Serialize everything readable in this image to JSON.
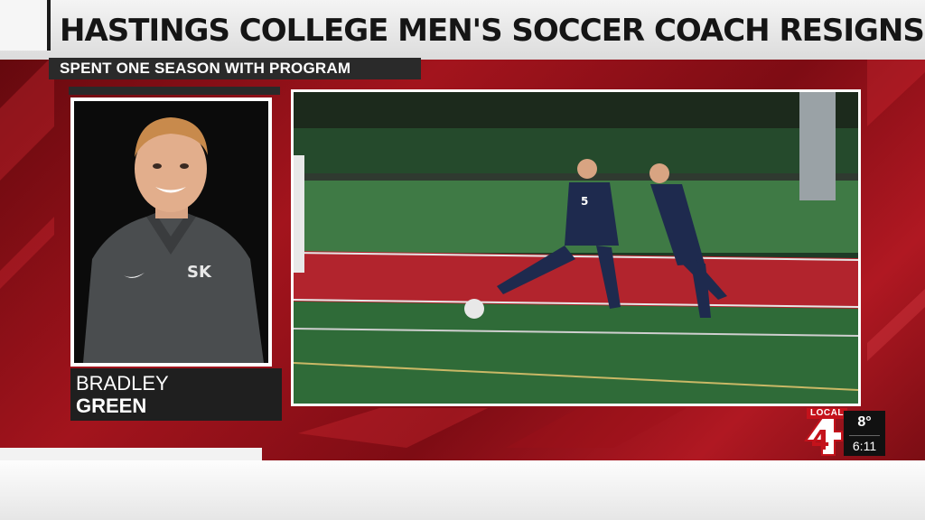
{
  "headline": "HASTINGS COLLEGE MEN'S SOCCER COACH RESIGNS",
  "subheadline": "SPENT ONE SEASON WITH PROGRAM",
  "lower_third": {
    "first_name": "BRADLEY",
    "last_name": "GREEN"
  },
  "player_jersey_numbers": [
    "5"
  ],
  "station": {
    "label": "LOCAL",
    "number": "4"
  },
  "weather": {
    "temperature": "8°",
    "time": "6:11"
  },
  "colors": {
    "accent_red": "#c4121b",
    "dark_bar": "#2a2a2a",
    "headline_text": "#151515"
  }
}
